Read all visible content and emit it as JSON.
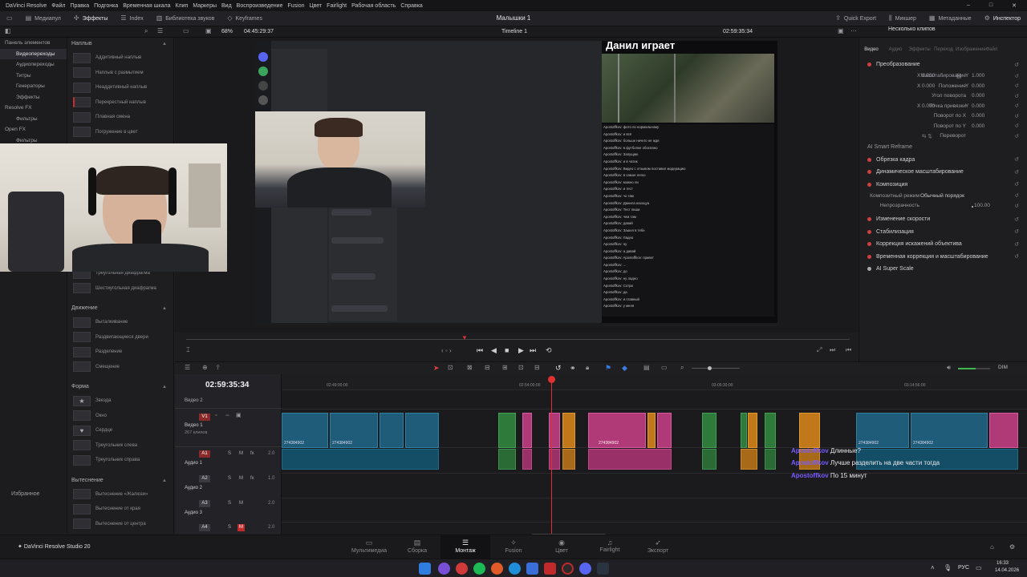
{
  "menu": [
    "DaVinci Resolve",
    "Файл",
    "Правка",
    "Подгонка",
    "Временная шкала",
    "Клип",
    "Маркеры",
    "Вид",
    "Воспроизведение",
    "Fusion",
    "Цвет",
    "Fairlight",
    "Рабочая область",
    "Справка"
  ],
  "toolbar": {
    "media_pool": "Медиапул",
    "effects": "Эффекты",
    "index": "Index",
    "sound_library": "Библиотека звуков",
    "keyframes": "Keyframes",
    "project_title": "Малышки 1",
    "quick_export": "Quick Export",
    "mixer": "Микшер",
    "metadata": "Метаданные",
    "inspector": "Инспектор"
  },
  "viewer_bar": {
    "zoom": "68%",
    "timecode_left": "04:45:29:37",
    "timeline_name": "Timeline 1",
    "timecode_right": "02:59:35:34"
  },
  "left_panel": {
    "title": "Панель элементов",
    "items": [
      "Видеопереходы",
      "Аудиопереходы",
      "Титры",
      "Генераторы",
      "Эффекты",
      "Resolve FX",
      "Фильтры",
      "Open FX",
      "Фильтры"
    ],
    "favorites": "Избранное"
  },
  "fx_panel": {
    "sec1": "Наплыв",
    "dissolves": [
      "Аддитивный наплыв",
      "Наплыв с размытием",
      "Неаддитивный наплыв",
      "Перекрестный наплыв",
      "Плавная смена",
      "Погружение в цвет"
    ],
    "iris_tail": [
      "Треугольная диафрагма",
      "Шестиугольная диафрагма"
    ],
    "sec2": "Движение",
    "motion": [
      "Выталкивание",
      "Раздвигающиеся двери",
      "Разделение",
      "Смещение"
    ],
    "sec3": "Форма",
    "shapes": [
      "Звезда",
      "Окно",
      "Сердце",
      "Треугольник слева",
      "Треугольник справа"
    ],
    "sec4": "Вытеснение",
    "wipes": [
      "Вытеснение «Жалюзи»",
      "Вытеснение от края",
      "Вытеснение от центра"
    ]
  },
  "screen": {
    "stream_title": "Данил играет",
    "chat_lines": [
      "Apostoffkov: фото по нормальному",
      "Apostoffkov: и всё",
      "Apostoffkov: больше ничего не ждя",
      "Apostoffkov: в футболке обоспано",
      "Apostoffkov: Запущаю",
      "Apostoffkov: и в чатик",
      "Apostoffkov: Видео с отзывом поставил модерацию",
      "Apostoffkov: в самое легко",
      "Apostoffkov: можно ли",
      "Apostoffkov: и тест",
      "Apostoffkov: чо там",
      "Apostoffkov: Данила нахоцуа",
      "Apostoffkov: Тест пиши",
      "Apostoffkov: чем там",
      "Apostoffkov: давай",
      "Apostoffkov: Зашел в тебе",
      "Apostoffkov: Ладно",
      "Apostoffkov: ну",
      "Apostoffkov: а давай",
      "Apostoffkov: Apostoffkov: привет",
      "Apostoffkov: ...",
      "Apostoffkov: до",
      "Apostoffkov: ну ладно",
      "Apostoffkov: Сотри",
      "Apostoffkov: да",
      "Apostoffkov: и главный",
      "Apostoffkov: у меня",
      "Apostoffkov: ...",
      "Apostoffkov: за участники",
      "Apostoffkov: Ладно, поеду"
    ]
  },
  "inspector": {
    "header": "Несколько клипов",
    "tabs": [
      "Видео",
      "Аудио",
      "Эффекты",
      "Переход",
      "Изображение",
      "Файл"
    ],
    "transform": "Преобразование",
    "rows": [
      {
        "label": "Масштабирование",
        "x": "1.000",
        "y": "1.000"
      },
      {
        "label": "Положение",
        "x": "0.000",
        "y": "0.000"
      },
      {
        "label": "Угол поворота",
        "x": "0.000",
        "y": ""
      },
      {
        "label": "Точка привязки",
        "x": "0.000",
        "y": "0.000"
      },
      {
        "label": "Поворот по X",
        "x": "0.000",
        "y": ""
      },
      {
        "label": "Поворот по Y",
        "x": "0.000",
        "y": ""
      },
      {
        "label": "Переворот",
        "x": "",
        "y": ""
      }
    ],
    "smart_reframe": "AI Smart Reframe",
    "sections": [
      "Обрезка кадра",
      "Динамическое масштабирование",
      "Композиция"
    ],
    "composite_mode_label": "Композитный режим",
    "composite_mode_value": "Обычный порядок",
    "opacity_label": "Непрозрачность",
    "opacity_value": "100.00",
    "sections2": [
      "Изменение скорости",
      "Стабилизация",
      "Коррекция искажений объектива",
      "Временная коррекция и масштабирование",
      "AI Super Scale"
    ]
  },
  "timeline": {
    "timecode": "02:59:35:34",
    "ruler": [
      "02:49:00:00",
      "02:54:00:00",
      "03:06:30:00",
      "03:14:56:00"
    ],
    "tracks": [
      {
        "name": "Видео 2",
        "tag": "",
        "sub": ""
      },
      {
        "name": "Видео 1",
        "tag": "V1",
        "sub": "267 клипов"
      },
      {
        "name": "Аудио 1",
        "tag": "A1",
        "sub": "2.0"
      },
      {
        "name": "Аудио 2",
        "tag": "A2",
        "sub": "1.0"
      },
      {
        "name": "Аудио 3",
        "tag": "A3",
        "sub": "2.0"
      },
      {
        "name": "",
        "tag": "A4",
        "sub": "2.0"
      }
    ],
    "clip_label": "274384902",
    "dim": "DIM"
  },
  "comments": [
    {
      "user": "Apostoffkov",
      "text": "Длинные?"
    },
    {
      "user": "Apostoffkov",
      "text": "Лучше разделить на две части тогда"
    },
    {
      "user": "Apostoffkov",
      "text": "По 15 минут"
    }
  ],
  "pages": [
    "Мультимедиа",
    "Сборка",
    "Монтаж",
    "Fusion",
    "Цвет",
    "Fairlight",
    "Экспорт"
  ],
  "active_page": "Монтаж",
  "app_name": "DaVinci Resolve Studio 20",
  "tray": {
    "lang": "РУС",
    "time": "16:33",
    "date": "14.04.2026"
  }
}
